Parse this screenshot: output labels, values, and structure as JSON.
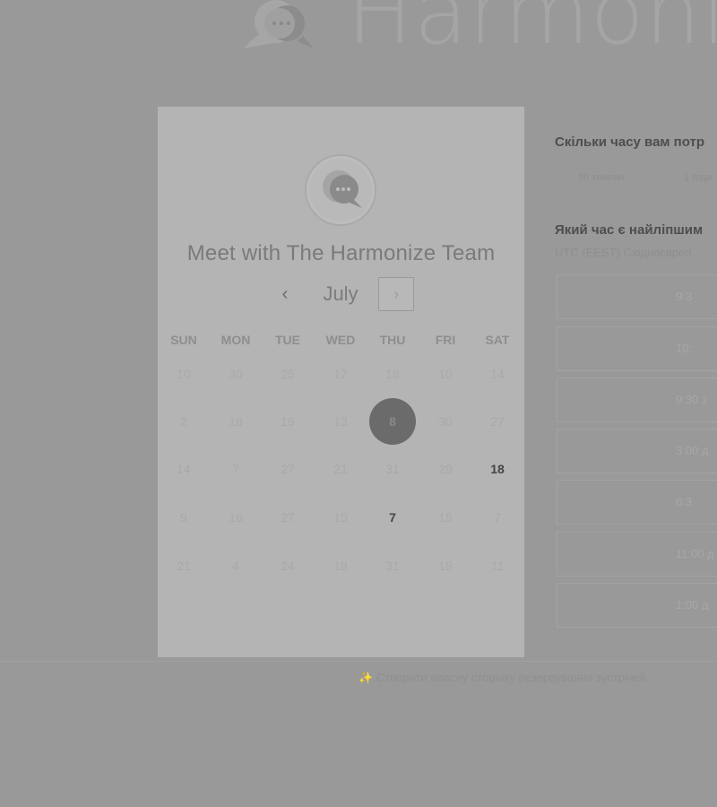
{
  "brand": {
    "logo_icon": "chat-bubbles-icon",
    "name": "Harmoni"
  },
  "card": {
    "title": "Meet with The Harmonize Team",
    "logo_icon": "chat-bubbles-icon",
    "month": "July",
    "prev_icon": "chevron-left-icon",
    "next_icon": "chevron-right-icon",
    "prev_glyph": "‹",
    "next_glyph": "›",
    "weekdays": [
      "SUN",
      "MON",
      "TUE",
      "WED",
      "THU",
      "FRI",
      "SAT"
    ],
    "weeks": [
      [
        {
          "d": "10"
        },
        {
          "d": "30"
        },
        {
          "d": "25"
        },
        {
          "d": "17"
        },
        {
          "d": "18"
        },
        {
          "d": "10"
        },
        {
          "d": "14"
        }
      ],
      [
        {
          "d": "2"
        },
        {
          "d": "18"
        },
        {
          "d": "19"
        },
        {
          "d": "13"
        },
        {
          "d": "8",
          "state": "selected"
        },
        {
          "d": "30"
        },
        {
          "d": "27"
        }
      ],
      [
        {
          "d": "14"
        },
        {
          "d": "7"
        },
        {
          "d": "27"
        },
        {
          "d": "21"
        },
        {
          "d": "31"
        },
        {
          "d": "29"
        },
        {
          "d": "18",
          "state": "available"
        }
      ],
      [
        {
          "d": "9"
        },
        {
          "d": "16"
        },
        {
          "d": "27"
        },
        {
          "d": "15"
        },
        {
          "d": "7",
          "state": "available"
        },
        {
          "d": "15"
        },
        {
          "d": "7"
        }
      ],
      [
        {
          "d": "21"
        },
        {
          "d": "4"
        },
        {
          "d": "24"
        },
        {
          "d": "18"
        },
        {
          "d": "31"
        },
        {
          "d": "18"
        },
        {
          "d": "11"
        }
      ]
    ]
  },
  "scheduler": {
    "duration_question": "Скільки часу вам потр",
    "durations": [
      "30 хвилин",
      "1 годи"
    ],
    "time_question": "Який час є найліпшим",
    "timezone": "UTC (EEST) Східноєвроп",
    "slots": [
      "9:3",
      "10:",
      "9:30 з",
      "3:00 д",
      "6:3",
      "11:00 д",
      "1:00 д"
    ]
  },
  "footer": {
    "link": "Створити власну сторінку резервування зустрічей"
  }
}
